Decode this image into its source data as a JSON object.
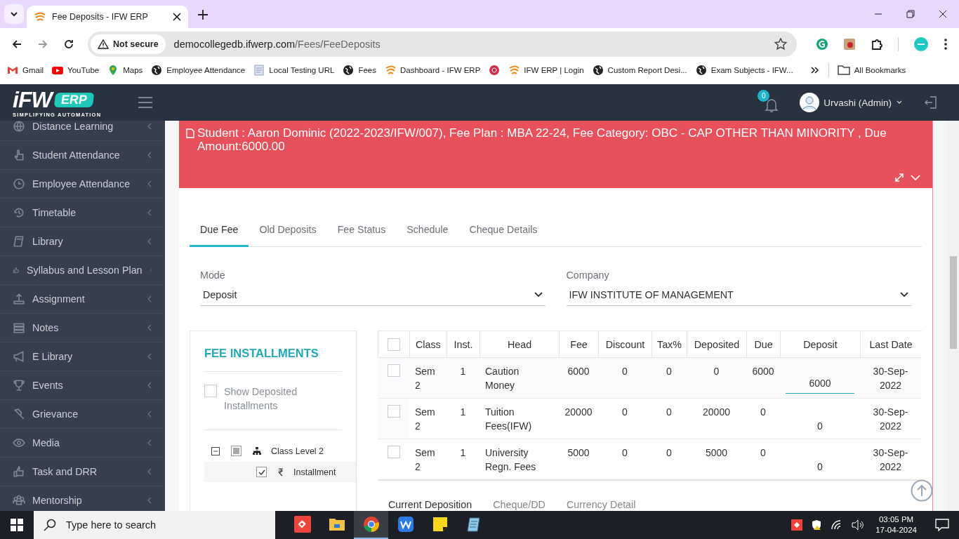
{
  "browser": {
    "tabs": [
      {
        "title": "Fee Deposits - IFW ERP",
        "selected": true
      }
    ],
    "address": {
      "security": "Not secure",
      "host": "democollegedb.ifwerp.com",
      "path": "/Fees/FeeDeposits"
    },
    "bookmarks": [
      {
        "label": "Gmail",
        "kind": "gmail"
      },
      {
        "label": "YouTube",
        "kind": "youtube"
      },
      {
        "label": "Maps",
        "kind": "maps"
      },
      {
        "label": "Employee Attendance",
        "kind": "globe"
      },
      {
        "label": "Local Testing URL",
        "kind": "doc"
      },
      {
        "label": "Fees",
        "kind": "globe"
      },
      {
        "label": "Dashboard - IFW ERP",
        "kind": "ifw"
      },
      {
        "kind": "target"
      },
      {
        "label": "IFW ERP | Login",
        "kind": "ifw"
      },
      {
        "label": "Custom Report Desi...",
        "kind": "globe"
      },
      {
        "label": "Exam Subjects - IFW...",
        "kind": "globe"
      }
    ],
    "all_bookmarks": "All Bookmarks"
  },
  "logo": {
    "word": "iFW",
    "badge": "ERP",
    "tagline": "SIMPLIFYING AUTOMATION"
  },
  "header": {
    "notifications": "0",
    "user": "Urvashi (Admin)"
  },
  "sidebar": {
    "items": [
      {
        "label": "Distance Learning"
      },
      {
        "label": "Student Attendance"
      },
      {
        "label": "Employee Attendance"
      },
      {
        "label": "Timetable"
      },
      {
        "label": "Library"
      },
      {
        "label": "Syllabus and Lesson Plan"
      },
      {
        "label": "Assignment"
      },
      {
        "label": "Notes"
      },
      {
        "label": "E Library"
      },
      {
        "label": "Events"
      },
      {
        "label": "Grievance"
      },
      {
        "label": "Media"
      },
      {
        "label": "Task and DRR"
      },
      {
        "label": "Mentorship"
      }
    ]
  },
  "banner": "Student : Aaron Dominic (2022-2023/IFW/007), Fee Plan : MBA 22-24, Fee Category: OBC - CAP OTHER THAN MINORITY , Due Amount:6000.00",
  "tabs": [
    {
      "label": "Due Fee",
      "selected": true
    },
    {
      "label": "Old Deposits",
      "selected": false
    },
    {
      "label": "Fee Status",
      "selected": false
    },
    {
      "label": "Schedule",
      "selected": false
    },
    {
      "label": "Cheque Details",
      "selected": false
    }
  ],
  "fields": [
    {
      "label": "Mode",
      "value": "Deposit"
    },
    {
      "label": "Company",
      "value": "IFW INSTITUTE OF MANAGEMENT"
    }
  ],
  "installments": {
    "title": "FEE INSTALLMENTS",
    "show_deposited": {
      "label": "Show Deposited Installments",
      "checked": false
    },
    "tree": [
      {
        "label": "Class Level 2",
        "expanded": true,
        "checked": false,
        "partial": true,
        "children": [
          {
            "label": "Installment",
            "checked": true
          }
        ]
      }
    ]
  },
  "table": {
    "all_checked": false,
    "columns": [
      "Class",
      "Inst.",
      "Head",
      "Fee",
      "Discount",
      "Tax%",
      "Deposited",
      "Due",
      "Deposit",
      "Last Date"
    ],
    "rows": [
      {
        "checked": false,
        "cells": [
          "Sem 2",
          "1",
          "Caution Money",
          "6000",
          "0",
          "0",
          "0",
          "6000"
        ],
        "deposit": {
          "kind": "input",
          "value": "6000"
        },
        "last_date": "30-Sep-2022"
      },
      {
        "checked": false,
        "cells": [
          "Sem 2",
          "1",
          "Tuition Fees(IFW)",
          "20000",
          "0",
          "0",
          "20000",
          "0"
        ],
        "deposit": {
          "kind": "text",
          "value": "0"
        },
        "last_date": "30-Sep-2022"
      },
      {
        "checked": false,
        "cells": [
          "Sem 2",
          "1",
          "University Regn. Fees",
          "5000",
          "0",
          "0",
          "5000",
          "0"
        ],
        "deposit": {
          "kind": "text",
          "value": "0"
        },
        "last_date": "30-Sep-2022"
      }
    ]
  },
  "subtabs": [
    {
      "label": "Current Deposition",
      "selected": true
    },
    {
      "label": "Cheque/DD",
      "selected": false
    },
    {
      "label": "Currency Detail",
      "selected": false
    }
  ],
  "taskbar": {
    "search": {
      "placeholder": "Type here to search"
    },
    "apps": [
      {
        "kind": "anydesk",
        "active": false
      },
      {
        "kind": "folder",
        "active": false
      },
      {
        "kind": "chrome",
        "active": true
      },
      {
        "kind": "wps",
        "active": false
      },
      {
        "kind": "sticky",
        "active": false
      },
      {
        "kind": "notepad",
        "active": false
      }
    ],
    "time": "03:05 PM",
    "date": "17-04-2024"
  }
}
